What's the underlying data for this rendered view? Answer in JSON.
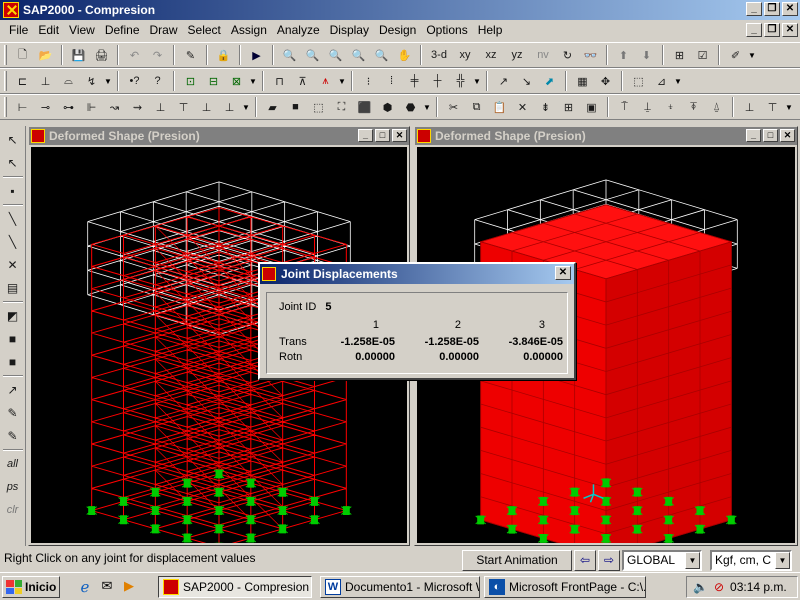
{
  "app": {
    "title": "SAP2000 - Compresion"
  },
  "menu": [
    "File",
    "Edit",
    "View",
    "Define",
    "Draw",
    "Select",
    "Assign",
    "Analyze",
    "Display",
    "Design",
    "Options",
    "Help"
  ],
  "toolbar1_text": [
    "3-d",
    "xy",
    "xz",
    "yz",
    "nv"
  ],
  "left_tools_text": [
    "all",
    "ps",
    "clr"
  ],
  "views": [
    {
      "title": "Deformed Shape (Presion)"
    },
    {
      "title": "Deformed Shape (Presion)"
    }
  ],
  "dialog": {
    "title": "Joint Displacements",
    "joint_id_label": "Joint ID",
    "joint_id": "5",
    "columns": [
      "1",
      "2",
      "3"
    ],
    "rows": [
      {
        "label": "Trans",
        "values": [
          "-1.258E-05",
          "-1.258E-05",
          "-3.846E-05"
        ]
      },
      {
        "label": "Rotn",
        "values": [
          "0.00000",
          "0.00000",
          "0.00000"
        ]
      }
    ]
  },
  "status": {
    "hint": "Right Click on any joint for displacement values",
    "animation_button": "Start Animation",
    "coord_system": "GLOBAL",
    "units": "Kgf, cm, C"
  },
  "taskbar": {
    "start": "Inicio",
    "tasks": [
      "SAP2000 - Compresion",
      "Documento1 - Microsoft W...",
      "Microsoft FrontPage - C:\\..."
    ],
    "clock": "03:14 p.m."
  },
  "colors": {
    "deformed": "#ff0000",
    "undeformed": "#ffffff",
    "support": "#00cc00",
    "selected_joint": "#00cccc"
  }
}
